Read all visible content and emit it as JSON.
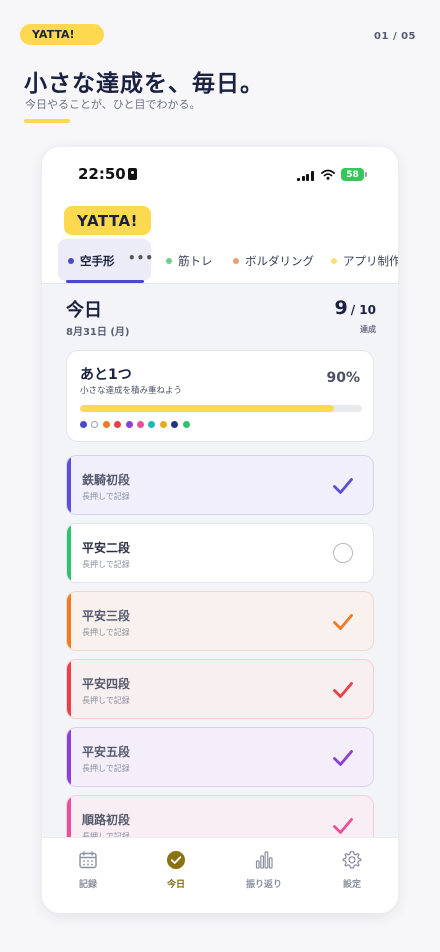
{
  "header": {
    "brand": "YATTA!",
    "page_counter": "01 / 05",
    "headline": "小さな達成を、毎日。",
    "subheadline": "今日やることが、ひと目でわかる。"
  },
  "status_bar": {
    "time": "22:50",
    "battery": "58"
  },
  "app": {
    "logo": "YATTA!",
    "tabs": [
      {
        "label": "空手形",
        "color": "#4a49c9",
        "active": true
      },
      {
        "label": "筋トレ",
        "color": "#6fd08c",
        "active": false
      },
      {
        "label": "ボルダリング",
        "color": "#e8a078",
        "active": false
      },
      {
        "label": "アプリ制作",
        "color": "#fbe07a",
        "active": false
      }
    ],
    "tab_more": "•••",
    "summary": {
      "title": "今日",
      "date": "8月31日 (月)",
      "done": "9",
      "total": "/ 10",
      "caption": "達成"
    },
    "progress": {
      "title": "あと1つ",
      "subtitle": "小さな達成を積み重ねよう",
      "percent_label": "90%",
      "fraction": 0.9,
      "dots": [
        "#4a49c9",
        "#ffffff",
        "#f07a22",
        "#e8404a",
        "#8b3fd9",
        "#ec4f9a",
        "#21b6b6",
        "#e8a91c",
        "#23308a",
        "#2fc36b"
      ]
    },
    "tasks": [
      {
        "name": "鉄騎初段",
        "hint": "長押しで記録",
        "done": true,
        "color": "#5a4fd6",
        "bg": "#f1effb",
        "border": "#d6d2f3"
      },
      {
        "name": "平安二段",
        "hint": "長押しで記録",
        "done": false,
        "color": "#2fc36b",
        "bg": "#ffffff",
        "border": "#e4e5ec"
      },
      {
        "name": "平安三段",
        "hint": "長押しで記録",
        "done": true,
        "color": "#f07a22",
        "bg": "#f8f1ee",
        "border": "#f2d8c8"
      },
      {
        "name": "平安四段",
        "hint": "長押しで記録",
        "done": true,
        "color": "#e8404a",
        "bg": "#f8eff0",
        "border": "#f2cfd2"
      },
      {
        "name": "平安五段",
        "hint": "長押しで記録",
        "done": true,
        "color": "#8b3fd9",
        "bg": "#f3eefa",
        "border": "#ddd0f2"
      },
      {
        "name": "順路初段",
        "hint": "長押しで記録",
        "done": true,
        "color": "#ec4f9a",
        "bg": "#f8eef3",
        "border": "#f2cfe0"
      }
    ],
    "nav": [
      {
        "label": "記録",
        "icon": "calendar-icon",
        "active": false
      },
      {
        "label": "今日",
        "icon": "check-circle-icon",
        "active": true
      },
      {
        "label": "振り返り",
        "icon": "bar-chart-icon",
        "active": false
      },
      {
        "label": "設定",
        "icon": "gear-icon",
        "active": false
      }
    ]
  }
}
